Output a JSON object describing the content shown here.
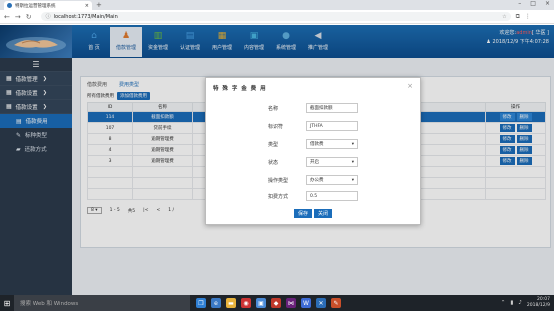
{
  "browser": {
    "tab_title": "特斯拉运营管理系统",
    "url": "localhost:1773/Main/Main"
  },
  "header": {
    "nav": [
      {
        "label": "首 页",
        "icon": "home-icon",
        "glyph": "⌂",
        "color": "#4aa3e8"
      },
      {
        "label": "借款管理",
        "icon": "user-icon",
        "glyph": "♟",
        "color": "#e07b2f"
      },
      {
        "label": "资金管理",
        "icon": "bar-chart-icon",
        "glyph": "▥",
        "color": "#6cbf3f"
      },
      {
        "label": "认证管理",
        "icon": "document-icon",
        "glyph": "▤",
        "color": "#4aa3e8"
      },
      {
        "label": "用户管理",
        "icon": "users-icon",
        "glyph": "▦",
        "color": "#e9b336"
      },
      {
        "label": "内容管理",
        "icon": "folder-icon",
        "glyph": "▣",
        "color": "#49b7e3"
      },
      {
        "label": "系统管理",
        "icon": "gear-icon",
        "glyph": "●",
        "color": "#5fb0e0"
      },
      {
        "label": "推广管理",
        "icon": "megaphone-icon",
        "glyph": "◀",
        "color": "#d8dfe8"
      }
    ],
    "welcome_prefix": "欢迎您:",
    "username": "admin",
    "welcome_suffix": "[ 华医 ]",
    "datetime": "2018/12/9 下午4:07:28"
  },
  "sidebar": {
    "groups": [
      {
        "label": "借款管理"
      },
      {
        "label": "借款设置"
      },
      {
        "label": "借款设置"
      }
    ],
    "items": [
      {
        "label": "借款费用"
      },
      {
        "label": "标种类型"
      },
      {
        "label": "还款方式"
      }
    ]
  },
  "content": {
    "tabs": [
      "借款费用",
      "费用类型"
    ],
    "filter_label": "所有借款费用",
    "add_button": "添加借款费用",
    "columns": [
      "ID",
      "名称",
      "操作"
    ],
    "rows": [
      {
        "id": "114",
        "name": "截面扣款额"
      },
      {
        "id": "107",
        "name": "贷前手续"
      },
      {
        "id": "8",
        "name": "逾期管理费"
      },
      {
        "id": "4",
        "name": "逾期管理费"
      },
      {
        "id": "3",
        "name": "逾期管理费"
      }
    ],
    "edit_label": "修改",
    "delete_label": "删除",
    "pager": {
      "page_size": "8",
      "range": "1 - 5",
      "total": "共5",
      "first": "|<",
      "prev": "<",
      "page": "1 /"
    }
  },
  "modal": {
    "title": "特 殊 字 金 费 用",
    "close": "×",
    "fields": [
      {
        "label": "名称",
        "value": "截面扣款额"
      },
      {
        "label": "标识符",
        "value": "JTHFA"
      },
      {
        "label": "类型",
        "value": "借款费"
      },
      {
        "label": "状态",
        "value": "开启"
      },
      {
        "label": "操作类型",
        "value": "办公费"
      },
      {
        "label": "扣费方式",
        "value": "0.5"
      }
    ],
    "save": "保存",
    "close_button": "关闭"
  },
  "taskbar": {
    "search_placeholder": "搜索 Web 和 Windows",
    "time": "20:07",
    "date": "2018/12/9"
  }
}
